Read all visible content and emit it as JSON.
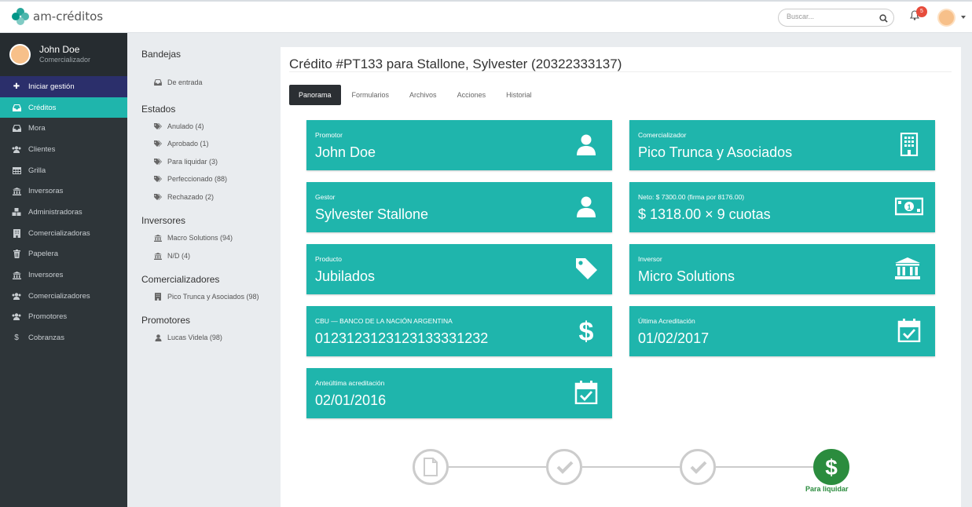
{
  "app": {
    "name": "am-créditos"
  },
  "search": {
    "placeholder": "Buscar..."
  },
  "notifications": {
    "count": "5"
  },
  "user": {
    "name": "John Doe",
    "role": "Comercializador"
  },
  "sidebar": {
    "items": [
      {
        "label": "Iniciar gestión",
        "icon": "plus-icon"
      },
      {
        "label": "Créditos",
        "icon": "inbox-icon"
      },
      {
        "label": "Mora",
        "icon": "inbox-icon"
      },
      {
        "label": "Clientes",
        "icon": "users-icon"
      },
      {
        "label": "Grilla",
        "icon": "table-icon"
      },
      {
        "label": "Inversoras",
        "icon": "bank-icon"
      },
      {
        "label": "Administradoras",
        "icon": "cubes-icon"
      },
      {
        "label": "Comercializadoras",
        "icon": "building-icon"
      },
      {
        "label": "Papelera",
        "icon": "trash-icon"
      },
      {
        "label": "Inversores",
        "icon": "bank-icon"
      },
      {
        "label": "Comercializadores",
        "icon": "users-icon"
      },
      {
        "label": "Promotores",
        "icon": "users-icon"
      },
      {
        "label": "Cobranzas",
        "icon": "dollar-icon"
      }
    ]
  },
  "filters": {
    "bandejas": {
      "title": "Bandejas",
      "items": [
        {
          "label": "De entrada"
        }
      ]
    },
    "estados": {
      "title": "Estados",
      "items": [
        {
          "label": "Anulado (4)"
        },
        {
          "label": "Aprobado (1)"
        },
        {
          "label": "Para liquidar (3)"
        },
        {
          "label": "Perfeccionado (88)"
        },
        {
          "label": "Rechazado (2)"
        }
      ]
    },
    "inversores": {
      "title": "Inversores",
      "items": [
        {
          "label": "Macro Solutions (94)"
        },
        {
          "label": "N/D (4)"
        }
      ]
    },
    "comercializadores": {
      "title": "Comercializadores",
      "items": [
        {
          "label": "Pico Trunca y Asociados (98)"
        }
      ]
    },
    "promotores": {
      "title": "Promotores",
      "items": [
        {
          "label": "Lucas Videla (98)"
        }
      ]
    }
  },
  "main": {
    "title": "Crédito #PT133 para Stallone, Sylvester (20322333137)",
    "tabs": [
      "Panorama",
      "Formularios",
      "Archivos",
      "Acciones",
      "Historial"
    ],
    "tiles": [
      {
        "label": "Promotor",
        "value": "John Doe",
        "icon": "user-icon"
      },
      {
        "label": "Comercializador",
        "value": "Pico Trunca y Asociados",
        "icon": "building-icon"
      },
      {
        "label": "Gestor",
        "value": "Sylvester Stallone",
        "icon": "user-icon"
      },
      {
        "label": "Neto: $ 7300.00 (firma por 8176.00)",
        "value": "$ 1318.00 × 9 cuotas",
        "icon": "money-icon"
      },
      {
        "label": "Producto",
        "value": "Jubilados",
        "icon": "tag-icon"
      },
      {
        "label": "Inversor",
        "value": "Micro Solutions",
        "icon": "bank-icon"
      },
      {
        "label": "CBU — BANCO DE LA NACIÓN ARGENTINA",
        "value": "0123123123123133331232",
        "icon": "dollar-icon"
      },
      {
        "label": "Última Acreditación",
        "value": "01/02/2017",
        "icon": "calendar-check-icon"
      },
      {
        "label": "Anteúltima acreditación",
        "value": "02/01/2016",
        "icon": "calendar-check-icon"
      }
    ],
    "progress": {
      "current_label": "Para liquidar"
    }
  },
  "colors": {
    "accent": "#1fb5ac",
    "sidebar": "#2e3539",
    "highlight": "#2b2f6b",
    "success": "#2b8c3e"
  }
}
